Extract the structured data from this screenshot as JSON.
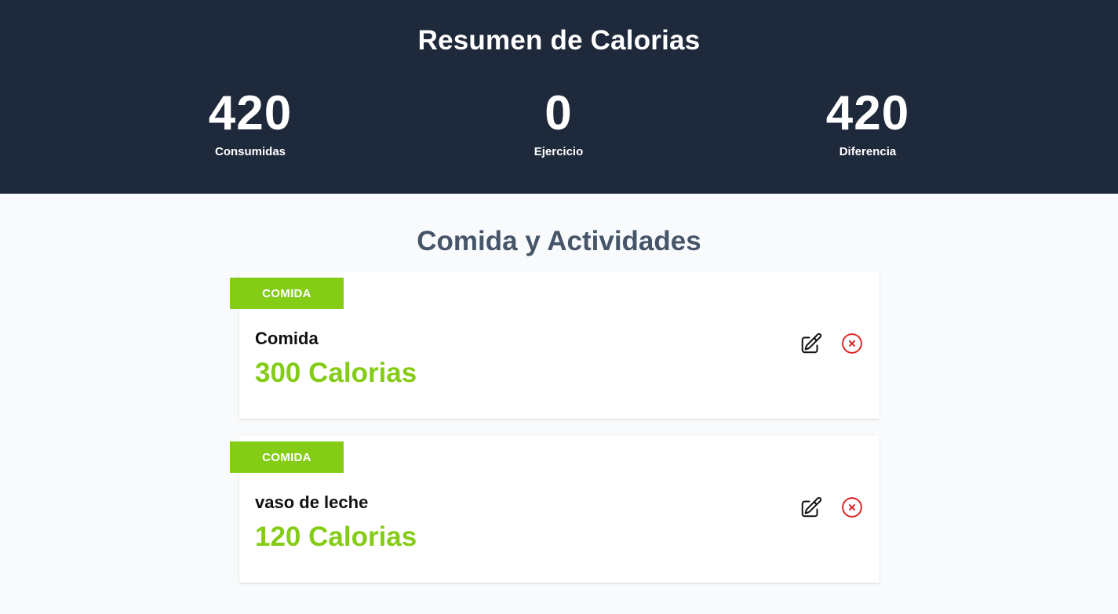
{
  "summary": {
    "title": "Resumen de Calorias",
    "stats": [
      {
        "value": "420",
        "label": "Consumidas"
      },
      {
        "value": "0",
        "label": "Ejercicio"
      },
      {
        "value": "420",
        "label": "Diferencia"
      }
    ]
  },
  "activities": {
    "title": "Comida y Actividades",
    "items": [
      {
        "category": "COMIDA",
        "name": "Comida",
        "calories": "300 Calorias"
      },
      {
        "category": "COMIDA",
        "name": "vaso de leche",
        "calories": "120 Calorias"
      }
    ]
  },
  "icons": {
    "edit": "pencil-square-icon",
    "delete": "x-circle-icon"
  },
  "colors": {
    "header_bg": "#1e293b",
    "accent": "#84cc16",
    "danger": "#dc2626",
    "section_title": "#475569"
  }
}
